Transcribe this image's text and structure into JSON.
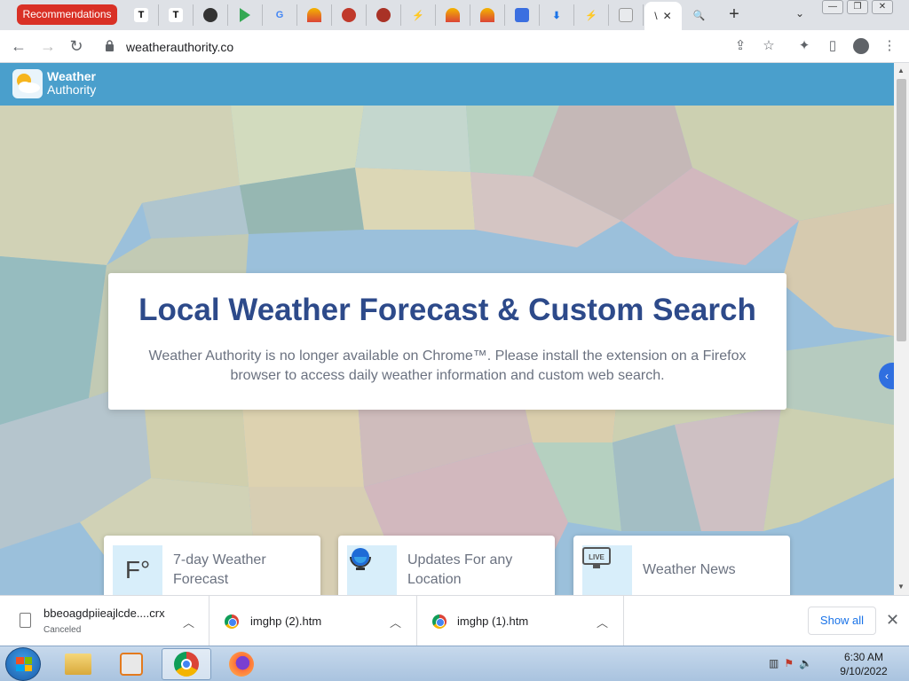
{
  "browser": {
    "recommendations_tab": "Recommendations",
    "active_tab_label": "\\",
    "url": "weatherauthority.co",
    "tab_icons": [
      "T",
      "T",
      "",
      "",
      "G",
      "",
      "",
      "",
      "",
      "",
      "",
      "",
      "",
      "",
      ""
    ]
  },
  "site": {
    "logo_line1": "Weather",
    "logo_line2": "Authority",
    "hero_title": "Local Weather Forecast & Custom Search",
    "hero_subtitle": "Weather Authority is no longer available on Chrome™. Please install the extension on a Firefox browser to access daily weather information and custom web search.",
    "features": [
      {
        "label_line1": "7-day Weather",
        "label_line2": "Forecast",
        "icon": "fahrenheit-icon",
        "icon_text": "F°"
      },
      {
        "label_line1": "Updates For any",
        "label_line2": "Location",
        "icon": "globe-icon"
      },
      {
        "label_line1": "Weather News",
        "label_line2": "",
        "icon": "live-tv-icon",
        "icon_text": "LIVE"
      }
    ],
    "side_tab": "‹"
  },
  "downloads": {
    "items": [
      {
        "name": "bbeoagdpiieajlcde....crx",
        "status": "Canceled"
      },
      {
        "name": "imghp (2).htm",
        "status": ""
      },
      {
        "name": "imghp (1).htm",
        "status": ""
      }
    ],
    "show_all": "Show all"
  },
  "taskbar": {
    "time": "6:30 AM",
    "date": "9/10/2022"
  },
  "colors": {
    "header": "#4a9fcc",
    "hero_title": "#2d4a8a",
    "recommendations": "#d93025"
  }
}
